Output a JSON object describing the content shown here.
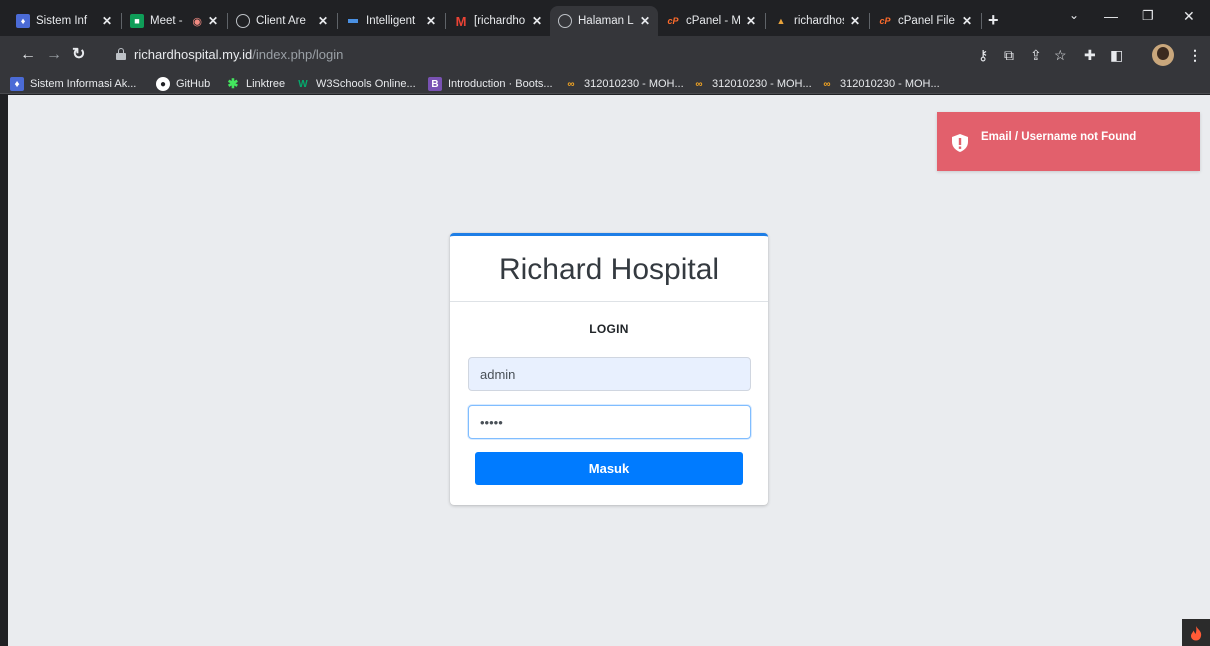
{
  "browser": {
    "tabs": [
      {
        "title": "Sistem Inf",
        "icon": "campus-icon",
        "color": "#4b6bd6"
      },
      {
        "title": "Meet - ",
        "icon": "meet-icon",
        "color": "#f4b400"
      },
      {
        "title": "Client Are",
        "icon": "globe-icon",
        "color": "#bdc1c6"
      },
      {
        "title": "Intelligent",
        "icon": "app-icon",
        "color": "#4a90e2"
      },
      {
        "title": "[richardho",
        "icon": "gmail-icon",
        "color": "#ea4335"
      },
      {
        "title": "Halaman L",
        "icon": "globe-icon",
        "color": "#bdc1c6",
        "active": true
      },
      {
        "title": "cPanel - M",
        "icon": "cpanel-icon",
        "color": "#ff6c2c"
      },
      {
        "title": "richardhos",
        "icon": "site-icon",
        "color": "#e8a33b"
      },
      {
        "title": "cPanel File",
        "icon": "cpanel-icon",
        "color": "#ff6c2c"
      }
    ],
    "url": {
      "host": "richardhospital.my.id",
      "path": "/index.php/login"
    },
    "bookmarks": [
      {
        "label": "Sistem Informasi Ak...",
        "icon": "campus-icon"
      },
      {
        "label": "GitHub",
        "icon": "github-icon"
      },
      {
        "label": "Linktree",
        "icon": "linktree-icon"
      },
      {
        "label": "W3Schools Online...",
        "icon": "w3schools-icon"
      },
      {
        "label": "Introduction · Boots...",
        "icon": "bootstrap-icon"
      },
      {
        "label": "312010230 - MOH...",
        "icon": "infinity-icon"
      },
      {
        "label": "312010230 - MOH...",
        "icon": "infinity-icon"
      },
      {
        "label": "312010230 - MOH...",
        "icon": "infinity-icon"
      }
    ]
  },
  "page": {
    "alert": {
      "message": "Email / Username not Found",
      "color": "#e2606c"
    },
    "login_card": {
      "title": "Richard Hospital",
      "heading": "LOGIN",
      "username_value": "admin",
      "password_value": "•••••",
      "submit_label": "Masuk",
      "accent": "#007bff"
    }
  }
}
